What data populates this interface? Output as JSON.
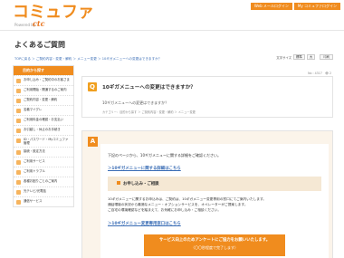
{
  "header": {
    "logo_text": "コミュファ",
    "logo_powered": "Powered by",
    "logo_ctc": "ctc",
    "top_links": [
      "Web メールログイン",
      "My コミュファログイン"
    ]
  },
  "page_title": "よくあるご質問",
  "breadcrumb": "TOPに戻る ＞ ご契約内容・変更・解約 ＞ メニュー変更 ＞ 10ギガメニューへの変更はできますか？",
  "sidebar": {
    "heading": "目的から探す",
    "items": [
      "お申し込み・ご契約中のお客さま",
      "ご利用開始・開通するのご案内",
      "ご契約内容・変更・解約",
      "名義マイグレ",
      "ご利用料金の確認・お支払い",
      "お引越し・休止のお手続き",
      "ID・パスワード・Myコミュファ管理",
      "接続・設定方法",
      "ご利用サービス",
      "ご利用トラブル",
      "各種お困りごとのご案内",
      "光テレビ/光電話",
      "通信サービス"
    ]
  },
  "toolbar": {
    "size_label": "文字サイズ",
    "size_options": [
      "標準",
      "大"
    ],
    "print_label": "印刷",
    "meta": "No : 4317　👁 2"
  },
  "question": {
    "badge": "Q",
    "title": "10ギガメニューへの変更はできますか？",
    "subtitle": "10ギガメニューへの変更はできますか？",
    "category": "カテゴリー：目的から探す ＞ ご契約内容・変更・解約 ＞ メニュー変更"
  },
  "answer": {
    "badge": "A",
    "intro": "下記のページから、10ギガメニューに関する詳細をご確認ください。",
    "link1": "＞10ギガメニューに関する詳細はこちら",
    "notice_title": "お申し込み・ご相談",
    "body_lines": [
      "10ギガメニューに関するお申込みは、ご契約は、10ギガメニュー変更専用の窓口にてご案内いたします。",
      "通話環境の状況から最適なメニュー・オプションサービスを、オペレーターがご提案します。",
      "ご自宅の環境確認などを踏まえて、お気軽にお申し込み・ご相談ください。"
    ],
    "link2": "＞10ギガメニュー変更専用窓口はこちら",
    "cta_title": "サービス向上のためアンケートにご協力をお願いいたします。",
    "cta_sub": "（〇〇秒程度で完了します）"
  },
  "colors": {
    "brand_orange": "#f08c1e",
    "link_blue": "#3a6db5",
    "answer_bg": "#fbf4ea"
  }
}
